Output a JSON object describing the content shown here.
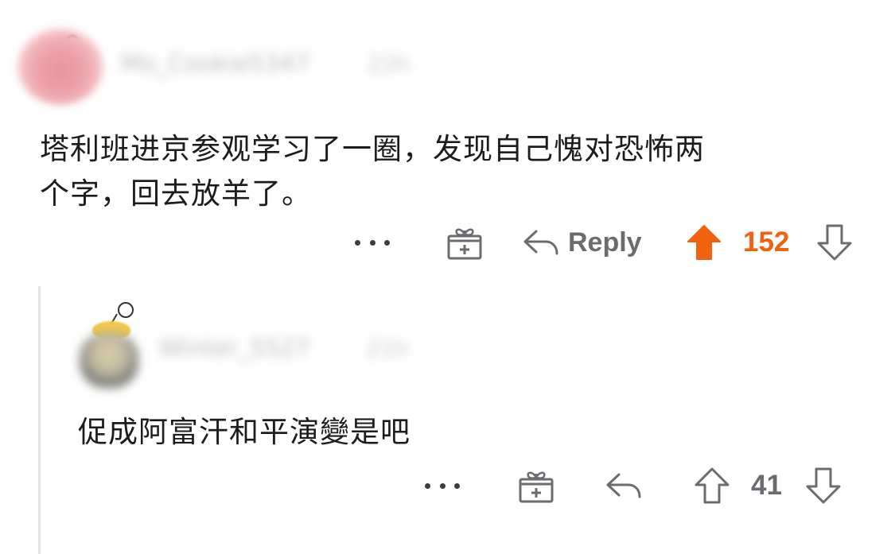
{
  "comment": {
    "username": "Mo_Cookie5347",
    "age": "22h",
    "body_line1": "塔利班进京参观学习了一圈，发现自己愧对恐怖两",
    "body_line2": "个字，回去放羊了。",
    "actions": {
      "reply_label": "Reply",
      "vote_count": "152",
      "upvoted": true,
      "accent_color": "#f0620f"
    }
  },
  "reply": {
    "username": "Winter_5527",
    "age": "21h",
    "body": "促成阿富汗和平演變是吧",
    "actions": {
      "vote_count": "41",
      "upvoted": false
    }
  },
  "icons": {
    "more": "more-icon",
    "award": "gift-icon",
    "reply": "reply-arrow-icon",
    "upvote": "upvote-icon",
    "downvote": "downvote-icon"
  }
}
